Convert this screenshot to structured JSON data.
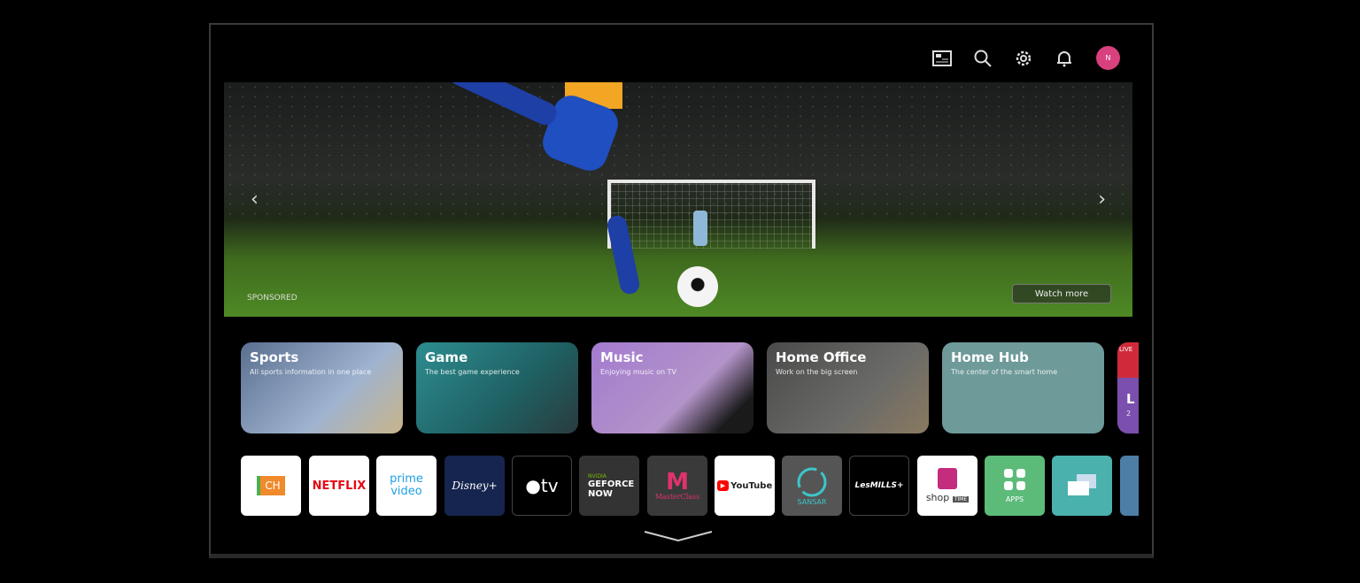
{
  "header": {
    "icons": [
      "guide-icon",
      "search-icon",
      "settings-icon",
      "notification-icon"
    ],
    "avatar_initial": "N",
    "avatar_color": "#d9407e"
  },
  "hero": {
    "sponsored_label": "SPONSORED",
    "watch_more_label": "Watch more",
    "prev": "‹",
    "next": "›"
  },
  "cards": [
    {
      "title": "Sports",
      "subtitle": "All sports information in one place"
    },
    {
      "title": "Game",
      "subtitle": "The best game experience"
    },
    {
      "title": "Music",
      "subtitle": "Enjoying music on TV"
    },
    {
      "title": "Home Office",
      "subtitle": "Work on the big screen"
    },
    {
      "title": "Home Hub",
      "subtitle": "The center of the smart home"
    },
    {
      "title": "L",
      "subtitle": "2",
      "badge": "LIVE"
    }
  ],
  "apps": [
    {
      "label": "CH"
    },
    {
      "label": "NETFLIX"
    },
    {
      "label": "prime video"
    },
    {
      "label": "Disney+"
    },
    {
      "label": "tv"
    },
    {
      "label": "GEFORCE NOW",
      "sub": "NVIDIA"
    },
    {
      "label": "MasterClass"
    },
    {
      "label": "YouTube"
    },
    {
      "label": "SANSAR"
    },
    {
      "label": "LesMILLS+"
    },
    {
      "label": "shop",
      "sub": "TIME"
    },
    {
      "label": "APPS"
    },
    {
      "label": "Screen Share"
    },
    {
      "label": ""
    }
  ]
}
